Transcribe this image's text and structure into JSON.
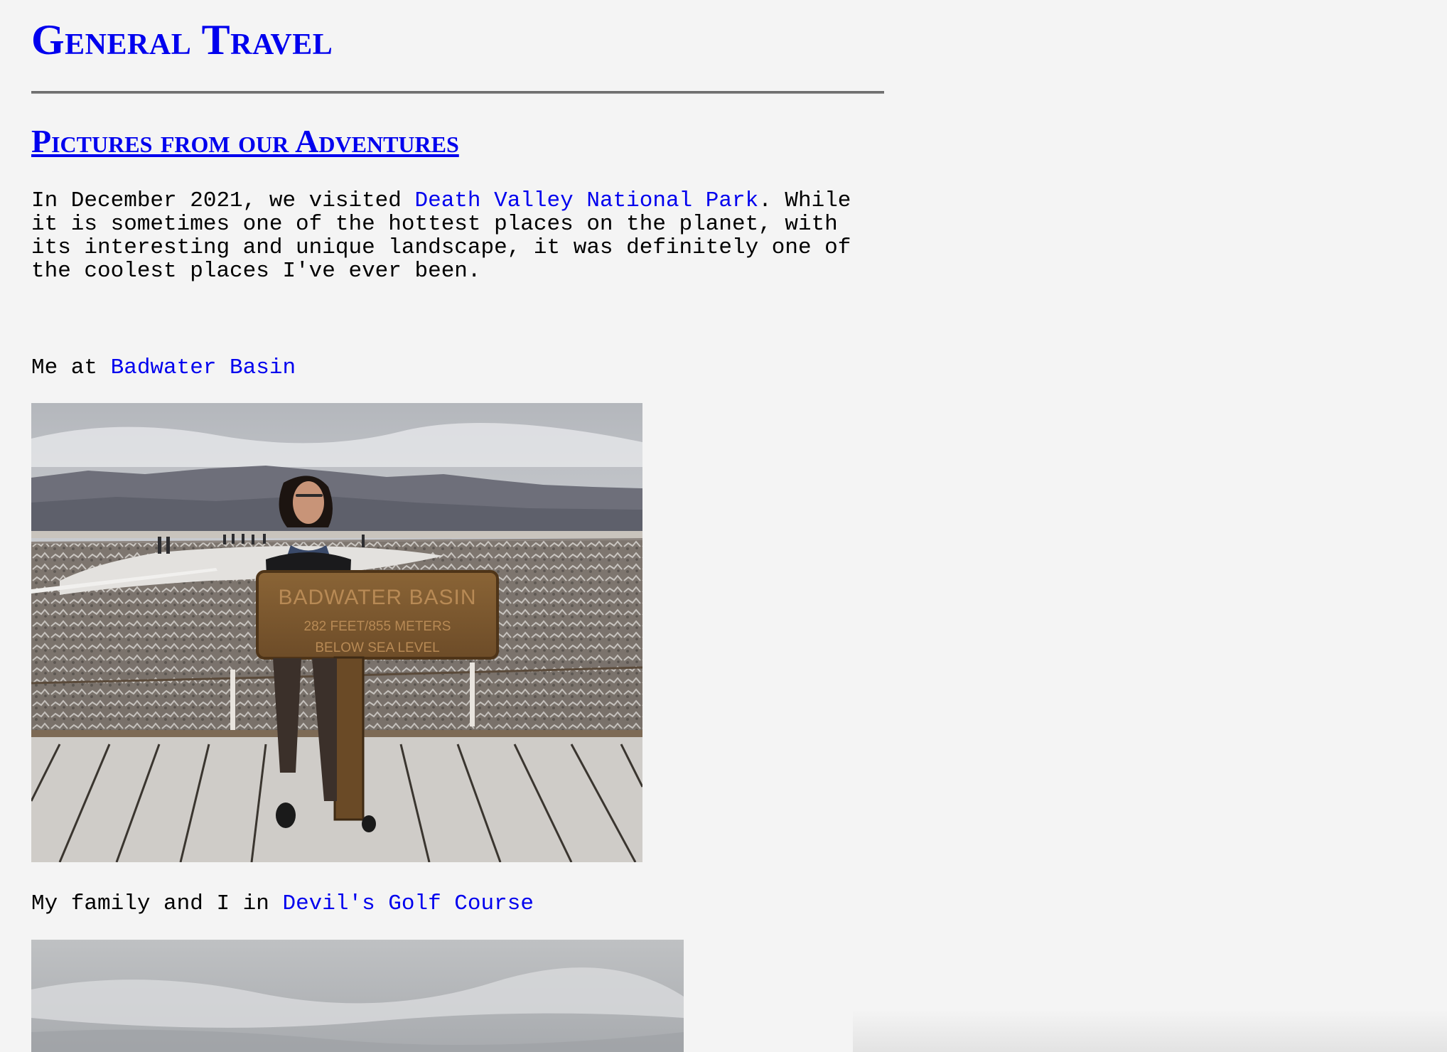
{
  "site": {
    "title": "General Travel"
  },
  "section": {
    "title": "Pictures from our Adventures"
  },
  "intro": {
    "line1_before": "In December 2021, we visited ",
    "park_link": "Death Valley National Park",
    "line1_after": ". While",
    "line2": "it is sometimes one of the hottest places on the planet, with",
    "line3": "its interesting and unique landscape, it was definitely one of",
    "line4": "the coolest places I've ever been."
  },
  "photos": [
    {
      "caption_before": "Me at ",
      "caption_link": "Badwater Basin",
      "sign": {
        "line1": "BADWATER BASIN",
        "line2": "282 FEET/855 METERS",
        "line3": "BELOW SEA LEVEL"
      }
    },
    {
      "caption_before": "My family and I in ",
      "caption_link": "Devil's Golf Course"
    }
  ]
}
